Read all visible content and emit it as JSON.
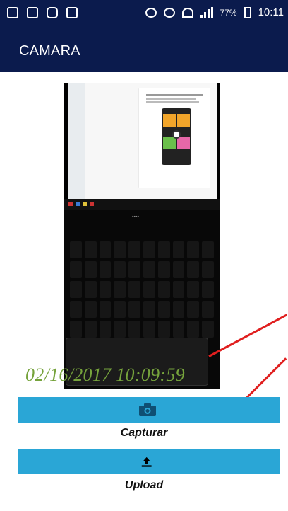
{
  "status_bar": {
    "battery_percent": "77%",
    "time": "10:11",
    "notification_icons": [
      "facebook-icon",
      "image-icon",
      "instagram-icon",
      "gallery-icon"
    ],
    "right_icons": [
      "mute-icon",
      "alarm-icon",
      "wifi-icon",
      "signal-icon",
      "battery-icon"
    ]
  },
  "app_bar": {
    "title": "CAMARA"
  },
  "preview": {
    "timestamp": "02/16/2017 10:09:59"
  },
  "actions": [
    {
      "label": "Capturar",
      "icon": "camera-icon"
    },
    {
      "label": "Upload",
      "icon": "upload-icon"
    }
  ],
  "colors": {
    "primary_dark": "#0b1b4d",
    "button": "#2aa6d6",
    "timestamp": "#76a33c",
    "annotation": "#e01f1f"
  }
}
